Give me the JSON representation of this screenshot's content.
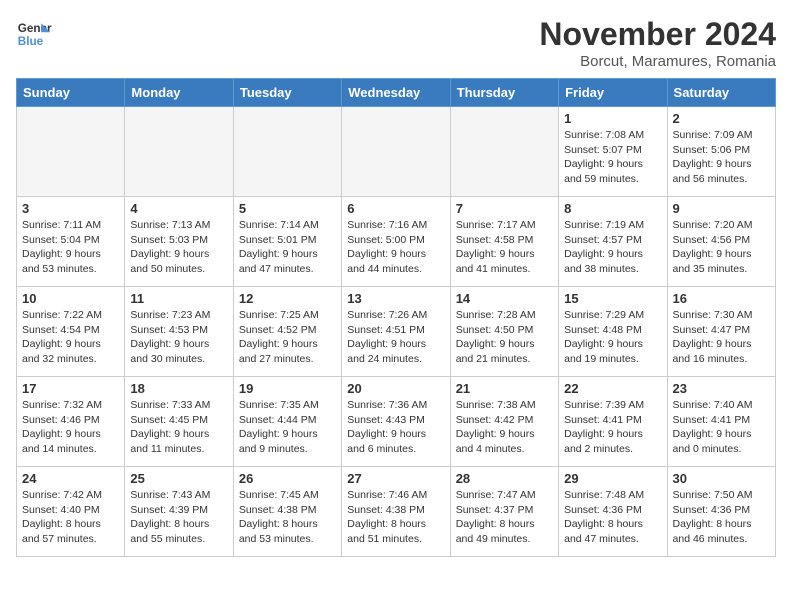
{
  "header": {
    "logo_line1": "General",
    "logo_line2": "Blue",
    "month_title": "November 2024",
    "location": "Borcut, Maramures, Romania"
  },
  "weekdays": [
    "Sunday",
    "Monday",
    "Tuesday",
    "Wednesday",
    "Thursday",
    "Friday",
    "Saturday"
  ],
  "weeks": [
    [
      {
        "day": "",
        "detail": ""
      },
      {
        "day": "",
        "detail": ""
      },
      {
        "day": "",
        "detail": ""
      },
      {
        "day": "",
        "detail": ""
      },
      {
        "day": "",
        "detail": ""
      },
      {
        "day": "1",
        "detail": "Sunrise: 7:08 AM\nSunset: 5:07 PM\nDaylight: 9 hours and 59 minutes."
      },
      {
        "day": "2",
        "detail": "Sunrise: 7:09 AM\nSunset: 5:06 PM\nDaylight: 9 hours and 56 minutes."
      }
    ],
    [
      {
        "day": "3",
        "detail": "Sunrise: 7:11 AM\nSunset: 5:04 PM\nDaylight: 9 hours and 53 minutes."
      },
      {
        "day": "4",
        "detail": "Sunrise: 7:13 AM\nSunset: 5:03 PM\nDaylight: 9 hours and 50 minutes."
      },
      {
        "day": "5",
        "detail": "Sunrise: 7:14 AM\nSunset: 5:01 PM\nDaylight: 9 hours and 47 minutes."
      },
      {
        "day": "6",
        "detail": "Sunrise: 7:16 AM\nSunset: 5:00 PM\nDaylight: 9 hours and 44 minutes."
      },
      {
        "day": "7",
        "detail": "Sunrise: 7:17 AM\nSunset: 4:58 PM\nDaylight: 9 hours and 41 minutes."
      },
      {
        "day": "8",
        "detail": "Sunrise: 7:19 AM\nSunset: 4:57 PM\nDaylight: 9 hours and 38 minutes."
      },
      {
        "day": "9",
        "detail": "Sunrise: 7:20 AM\nSunset: 4:56 PM\nDaylight: 9 hours and 35 minutes."
      }
    ],
    [
      {
        "day": "10",
        "detail": "Sunrise: 7:22 AM\nSunset: 4:54 PM\nDaylight: 9 hours and 32 minutes."
      },
      {
        "day": "11",
        "detail": "Sunrise: 7:23 AM\nSunset: 4:53 PM\nDaylight: 9 hours and 30 minutes."
      },
      {
        "day": "12",
        "detail": "Sunrise: 7:25 AM\nSunset: 4:52 PM\nDaylight: 9 hours and 27 minutes."
      },
      {
        "day": "13",
        "detail": "Sunrise: 7:26 AM\nSunset: 4:51 PM\nDaylight: 9 hours and 24 minutes."
      },
      {
        "day": "14",
        "detail": "Sunrise: 7:28 AM\nSunset: 4:50 PM\nDaylight: 9 hours and 21 minutes."
      },
      {
        "day": "15",
        "detail": "Sunrise: 7:29 AM\nSunset: 4:48 PM\nDaylight: 9 hours and 19 minutes."
      },
      {
        "day": "16",
        "detail": "Sunrise: 7:30 AM\nSunset: 4:47 PM\nDaylight: 9 hours and 16 minutes."
      }
    ],
    [
      {
        "day": "17",
        "detail": "Sunrise: 7:32 AM\nSunset: 4:46 PM\nDaylight: 9 hours and 14 minutes."
      },
      {
        "day": "18",
        "detail": "Sunrise: 7:33 AM\nSunset: 4:45 PM\nDaylight: 9 hours and 11 minutes."
      },
      {
        "day": "19",
        "detail": "Sunrise: 7:35 AM\nSunset: 4:44 PM\nDaylight: 9 hours and 9 minutes."
      },
      {
        "day": "20",
        "detail": "Sunrise: 7:36 AM\nSunset: 4:43 PM\nDaylight: 9 hours and 6 minutes."
      },
      {
        "day": "21",
        "detail": "Sunrise: 7:38 AM\nSunset: 4:42 PM\nDaylight: 9 hours and 4 minutes."
      },
      {
        "day": "22",
        "detail": "Sunrise: 7:39 AM\nSunset: 4:41 PM\nDaylight: 9 hours and 2 minutes."
      },
      {
        "day": "23",
        "detail": "Sunrise: 7:40 AM\nSunset: 4:41 PM\nDaylight: 9 hours and 0 minutes."
      }
    ],
    [
      {
        "day": "24",
        "detail": "Sunrise: 7:42 AM\nSunset: 4:40 PM\nDaylight: 8 hours and 57 minutes."
      },
      {
        "day": "25",
        "detail": "Sunrise: 7:43 AM\nSunset: 4:39 PM\nDaylight: 8 hours and 55 minutes."
      },
      {
        "day": "26",
        "detail": "Sunrise: 7:45 AM\nSunset: 4:38 PM\nDaylight: 8 hours and 53 minutes."
      },
      {
        "day": "27",
        "detail": "Sunrise: 7:46 AM\nSunset: 4:38 PM\nDaylight: 8 hours and 51 minutes."
      },
      {
        "day": "28",
        "detail": "Sunrise: 7:47 AM\nSunset: 4:37 PM\nDaylight: 8 hours and 49 minutes."
      },
      {
        "day": "29",
        "detail": "Sunrise: 7:48 AM\nSunset: 4:36 PM\nDaylight: 8 hours and 47 minutes."
      },
      {
        "day": "30",
        "detail": "Sunrise: 7:50 AM\nSunset: 4:36 PM\nDaylight: 8 hours and 46 minutes."
      }
    ]
  ]
}
